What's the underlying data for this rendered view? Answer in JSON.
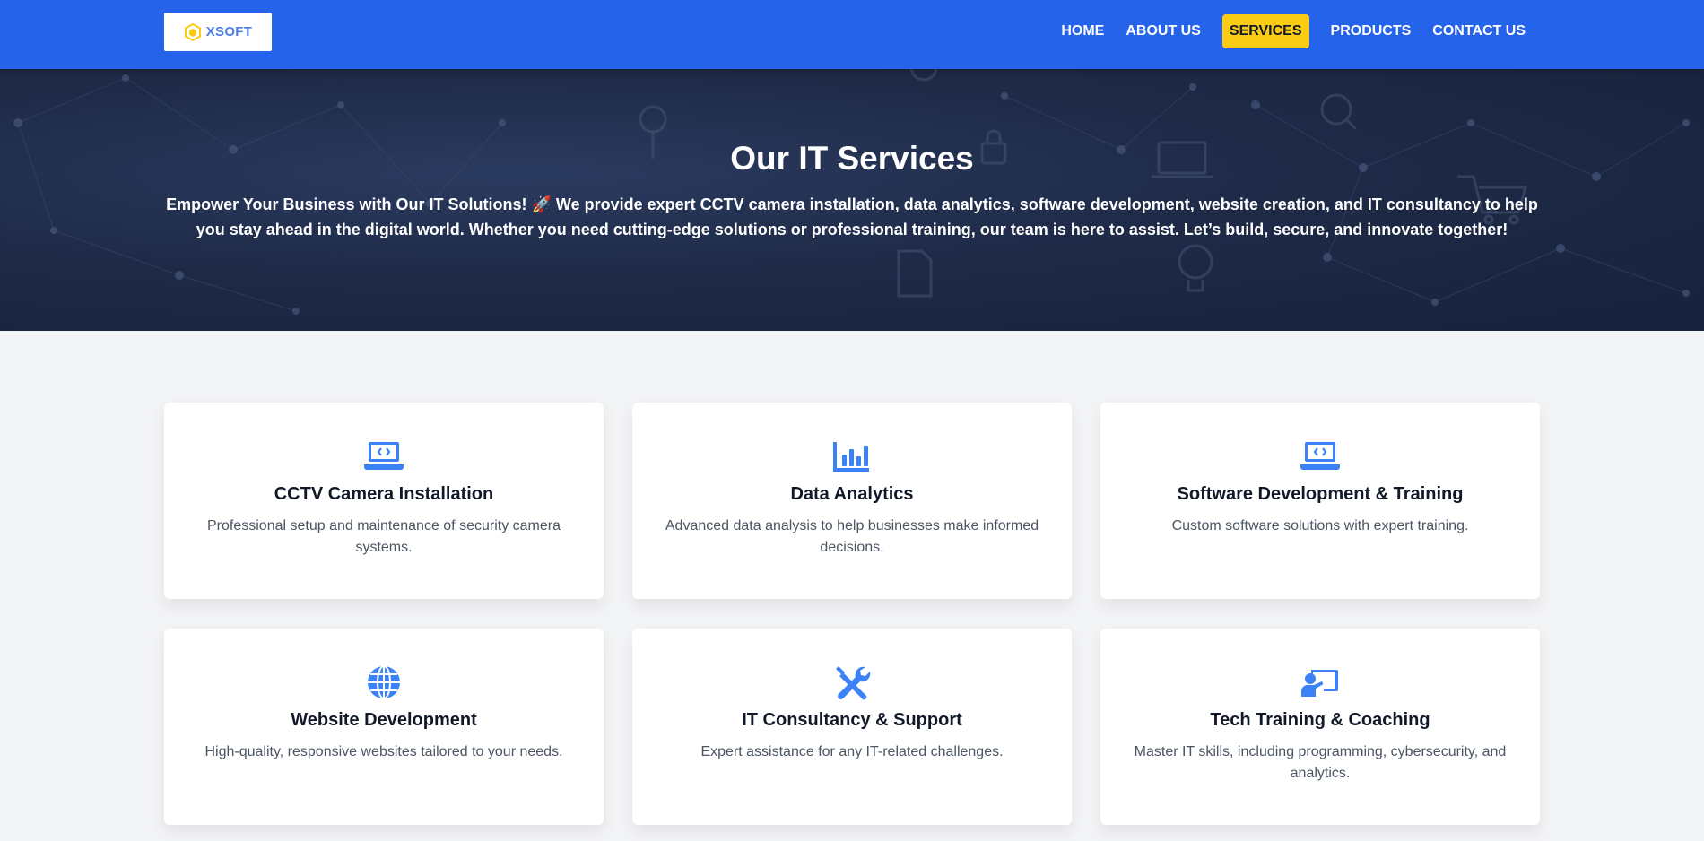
{
  "brand": {
    "name": "XSOFT",
    "logo_icon": "hexagon-logo-icon"
  },
  "nav": {
    "items": [
      {
        "label": "HOME",
        "active": false
      },
      {
        "label": "ABOUT US",
        "active": false
      },
      {
        "label": "SERVICES",
        "active": true
      },
      {
        "label": "PRODUCTS",
        "active": false
      },
      {
        "label": "CONTACT US",
        "active": false
      }
    ]
  },
  "hero": {
    "title": "Our IT Services",
    "text": "Empower Your Business with Our IT Solutions! 🚀 We provide expert CCTV camera installation, data analytics, software development, website creation, and IT consultancy to help you stay ahead in the digital world. Whether you need cutting-edge solutions or professional training, our team is here to assist. Let’s build, secure, and innovate together!"
  },
  "services": [
    {
      "icon": "laptop-code-icon",
      "title": "CCTV Camera Installation",
      "description": "Professional setup and maintenance of security camera systems."
    },
    {
      "icon": "chart-bar-icon",
      "title": "Data Analytics",
      "description": "Advanced data analysis to help businesses make informed decisions."
    },
    {
      "icon": "laptop-code-icon",
      "title": "Software Development & Training",
      "description": "Custom software solutions with expert training."
    },
    {
      "icon": "globe-icon",
      "title": "Website Development",
      "description": "High-quality, responsive websites tailored to your needs."
    },
    {
      "icon": "tools-icon",
      "title": "IT Consultancy & Support",
      "description": "Expert assistance for any IT-related challenges."
    },
    {
      "icon": "chalkboard-teacher-icon",
      "title": "Tech Training & Coaching",
      "description": "Master IT skills, including programming, cybersecurity, and analytics."
    }
  ],
  "colors": {
    "nav_bg": "#2563eb",
    "active_bg": "#facc15",
    "icon_blue": "#3b82f6",
    "hero_bg": "#1e2a47"
  }
}
